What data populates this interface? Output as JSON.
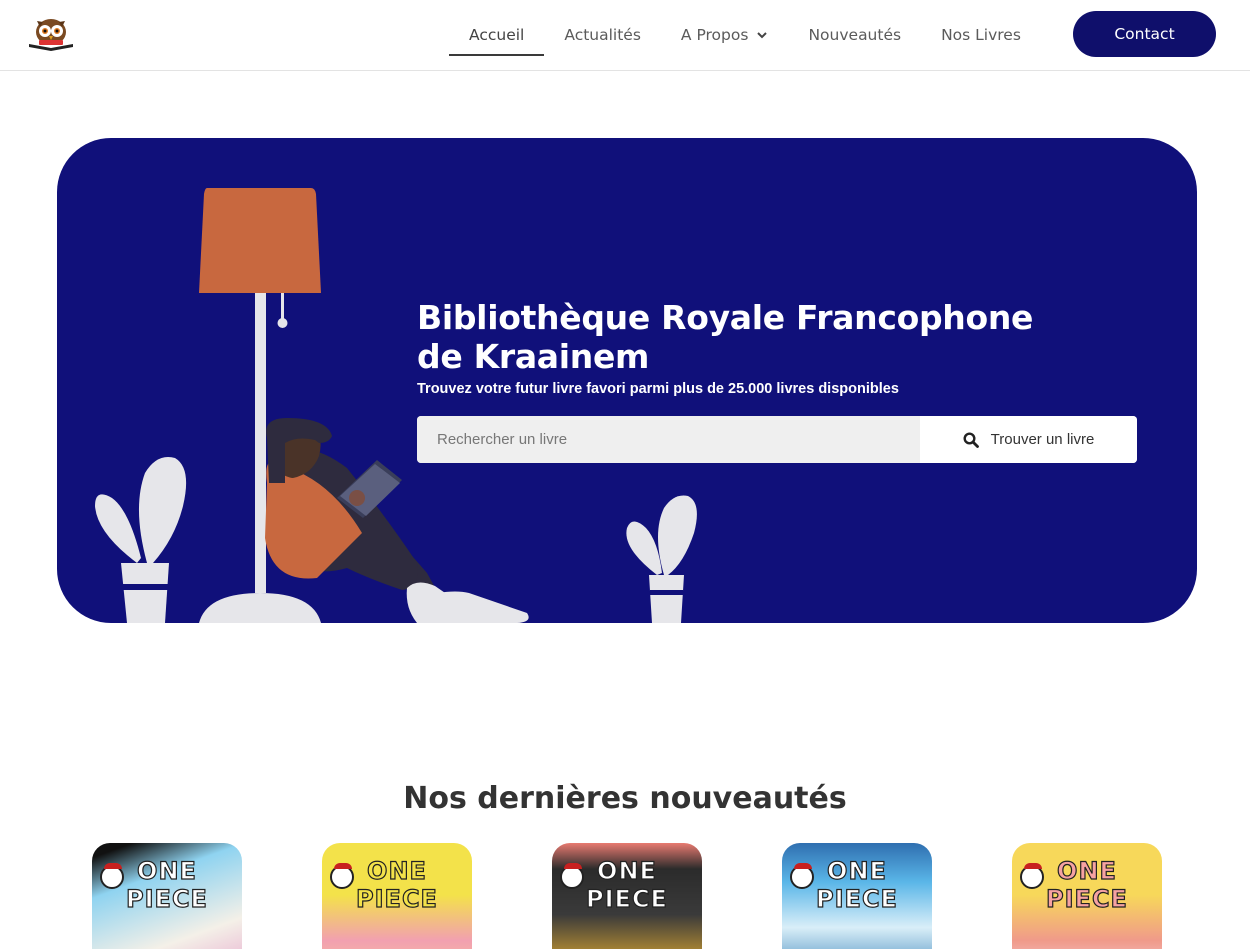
{
  "header": {
    "logo_icon": "owl-reading-book-icon",
    "nav": [
      {
        "label": "Accueil",
        "active": true
      },
      {
        "label": "Actualités",
        "active": false
      },
      {
        "label": "A Propos",
        "active": false,
        "has_dropdown": true
      },
      {
        "label": "Nouveautés",
        "active": false
      },
      {
        "label": "Nos Livres",
        "active": false
      }
    ],
    "contact_label": "Contact"
  },
  "hero": {
    "title_line1": "Bibliothèque Royale Francophone",
    "title_line2": "de Kraainem",
    "subtitle": "Trouvez votre futur livre favori parmi plus de 25.000 livres disponibles",
    "search_placeholder": "Rechercher un livre",
    "search_button_label": "Trouver un livre",
    "search_icon": "search-icon"
  },
  "section": {
    "title": "Nos dernières nouveautés",
    "books": [
      {
        "cover_text": "ONE PIECE",
        "colors": [
          "#8fd3f0",
          "#f4f0e8"
        ]
      },
      {
        "cover_text": "ONE PIECE",
        "colors": [
          "#f3e24a",
          "#f2a0b0"
        ]
      },
      {
        "cover_text": "ONE PIECE",
        "colors": [
          "#2b2b2b",
          "#e8b030"
        ]
      },
      {
        "cover_text": "ONE PIECE",
        "colors": [
          "#5ab6e8",
          "#d9eef8"
        ]
      },
      {
        "cover_text": "ONE PIECE",
        "colors": [
          "#f7d85a",
          "#f09a8a"
        ]
      }
    ]
  },
  "colors": {
    "brand_navy": "#10107a",
    "contact_button": "#0f0f6b",
    "lamp_shade": "#c8683f",
    "plants": "#e6e6ea",
    "person_sweater": "#c8683f"
  }
}
